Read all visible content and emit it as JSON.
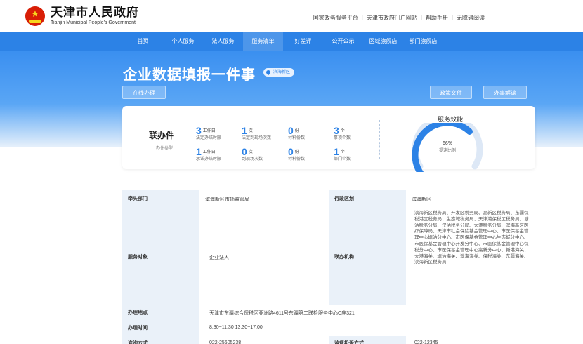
{
  "header": {
    "logo_cn": "天津市人民政府",
    "logo_en": "Tianjin Municipal People's Government",
    "top_links": [
      "国家政务服务平台",
      "天津市政府门户网站",
      "帮助手册",
      "无障碍阅读"
    ]
  },
  "nav": {
    "items": [
      "首页",
      "个人服务",
      "法人服务",
      "服务清单",
      "好差评",
      "公开公示",
      "区域旗舰店",
      "部门旗舰店"
    ]
  },
  "banner": {
    "title": "企业数据填报一件事",
    "region": "滨海新区",
    "btn_online": "在线办理",
    "btn_guide": "政策文件",
    "btn_help": "办事解读"
  },
  "stats": {
    "title": "联办件",
    "subtitle": "办件类型",
    "items": [
      {
        "num": "3",
        "unit": "工作日",
        "label": "法定办结时限"
      },
      {
        "num": "1",
        "unit": "次",
        "label": "法定到现场次数"
      },
      {
        "num": "0",
        "unit": "份",
        "label": "材料份数"
      },
      {
        "num": "3",
        "unit": "个",
        "label": "事项个数"
      },
      {
        "num": "1",
        "unit": "工作日",
        "label": "承诺办结时限"
      },
      {
        "num": "0",
        "unit": "次",
        "label": "到现场次数"
      },
      {
        "num": "0",
        "unit": "份",
        "label": "材料份数"
      },
      {
        "num": "1",
        "unit": "个",
        "label": "部门个数"
      }
    ],
    "efficiency_title": "服务效能",
    "efficiency_pct": "66%",
    "efficiency_value": 0.66,
    "efficiency_label": "提速比例"
  },
  "info": {
    "lead_dept_label": "牵头部门",
    "lead_dept_value": "滨海新区市场监管局",
    "region_label": "行政区划",
    "region_value": "滨海新区",
    "target_label": "服务对象",
    "target_value": "企业法人",
    "joint_label": "联办机构",
    "joint_value": "滨海新区税务局、开发区税务局、高新区税务局、东疆保税港区税务局、生态城税务局、天津港保税区税务局、塘沽税务分局、汉沽税务分局、大港税务分局、滨海新区医疗保障局、天津市社会保险基金管理中心、市医保基金管理中心塘沽分中心、市医保基金管理中心生态城分中心、市医保基金管理中心开发分中心、市医保基金管理中心保税分中心、市医保基金管理中心高新分中心、新港海关、大港海关、塘沽海关、滨海海关、保税海关、东疆海关、滨海新区税务局",
    "address_label": "办理地点",
    "address_value": "天津市东疆综合保税区亚洲路4611号东疆第二联检服务中心C座321",
    "time_label": "办理时间",
    "time_value": "8:30~11:30 13:30~17:00",
    "contact_label": "咨询方式",
    "contact_value": "022-25605238",
    "complaint_label": "监督投诉方式",
    "complaint_value": "022-12345"
  }
}
